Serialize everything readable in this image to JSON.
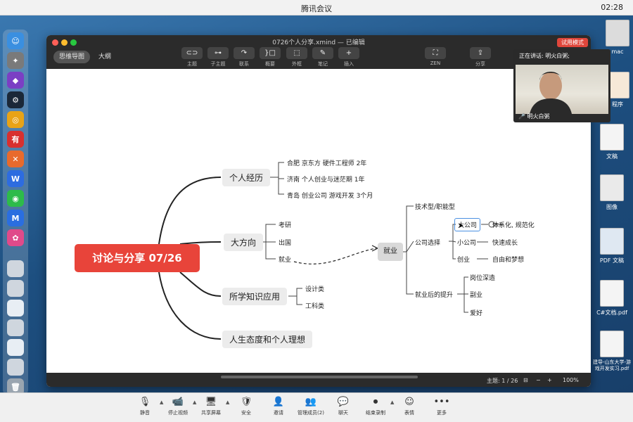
{
  "meeting": {
    "title": "腾讯会议",
    "clock": "02:28",
    "toolbar": [
      {
        "label": "静音",
        "icon": "🎙"
      },
      {
        "label": "停止视频",
        "icon": "📹"
      },
      {
        "label": "共享屏幕",
        "icon": "🖥"
      },
      {
        "label": "安全",
        "icon": "🛡"
      },
      {
        "label": "邀请",
        "icon": "👤"
      },
      {
        "label": "管理成员(2)",
        "icon": "👥"
      },
      {
        "label": "聊天",
        "icon": "💬"
      },
      {
        "label": "结束录制",
        "icon": "⏺"
      },
      {
        "label": "表情",
        "icon": "☺"
      },
      {
        "label": "更多",
        "icon": "•••"
      }
    ]
  },
  "webcam": {
    "speaking": "正在讲话: 明火白粥;",
    "name": "明火白粥"
  },
  "desktop_icons": [
    {
      "label": "mac"
    },
    {
      "label": "程序"
    },
    {
      "label": "文稿"
    },
    {
      "label": "图像"
    },
    {
      "label": "PDF 文稿"
    },
    {
      "label": "C#文档.pdf"
    },
    {
      "label": "建导-山东大学-游戏开发实习.pdf"
    }
  ],
  "window": {
    "doc_title": "0726个人分享.xmind — 已编辑",
    "trial": "试用模式",
    "tabs": [
      "思维导图",
      "大纲"
    ],
    "tools": [
      {
        "label": "主题",
        "icon": "⊂⊃"
      },
      {
        "label": "子主题",
        "icon": "⊶"
      },
      {
        "label": "联系",
        "icon": "↷"
      },
      {
        "label": "概要",
        "icon": "}□"
      },
      {
        "label": "外框",
        "icon": "⬚"
      },
      {
        "label": "笔记",
        "icon": "✎"
      },
      {
        "label": "插入",
        "icon": "+"
      },
      {
        "label": "ZEN",
        "icon": "⛶"
      },
      {
        "label": "分享",
        "icon": "⇪"
      }
    ],
    "status": {
      "topic": "主题: 1 / 26",
      "zoom": "100%"
    }
  },
  "mindmap": {
    "central": "讨论与分享 07/26",
    "main_topics": [
      "个人经历",
      "大方向",
      "所学知识应用",
      "人生态度和个人理想"
    ],
    "experience": [
      "合肥 京东方 硬件工程师 2年",
      "济南 个人创业与迷茫期 1年",
      "青岛 创业公司 游戏开发 3个月"
    ],
    "direction": [
      "考研",
      "出国",
      "就业"
    ],
    "knowledge": [
      "设计类",
      "工科类"
    ],
    "employment": "就业",
    "employment_children": [
      "技术型/职能型",
      "公司选择",
      "就业后的提升"
    ],
    "company": [
      "大公司",
      "小公司",
      "创业"
    ],
    "company_notes": [
      "体系化, 规范化",
      "快速成长",
      "自由和梦想"
    ],
    "improvement": [
      "岗位深造",
      "副业",
      "爱好"
    ]
  }
}
